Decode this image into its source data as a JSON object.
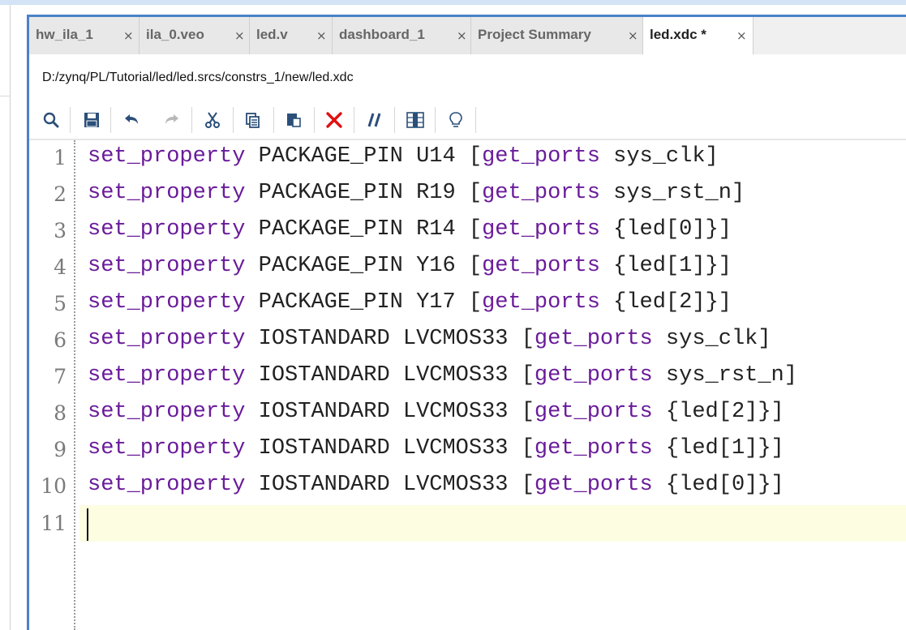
{
  "tabs": [
    {
      "label": "hw_ila_1",
      "active": false
    },
    {
      "label": "ila_0.veo",
      "active": false
    },
    {
      "label": "led.v",
      "active": false
    },
    {
      "label": "dashboard_1",
      "active": false
    },
    {
      "label": "Project Summary",
      "active": false
    },
    {
      "label": "led.xdc *",
      "active": true
    }
  ],
  "close_glyph": "×",
  "file_path": "D:/zynq/PL/Tutorial/led/led.srcs/constrs_1/new/led.xdc",
  "toolbar": [
    {
      "icon": "search-icon"
    },
    {
      "icon": "save-icon"
    },
    {
      "icon": "undo-icon"
    },
    {
      "icon": "redo-icon"
    },
    {
      "icon": "cut-icon"
    },
    {
      "icon": "copy-icon"
    },
    {
      "icon": "paste-icon"
    },
    {
      "icon": "delete-icon"
    },
    {
      "icon": "comment-icon"
    },
    {
      "icon": "column-select-icon"
    },
    {
      "icon": "lightbulb-icon"
    }
  ],
  "colors": {
    "keyword": "#6a1b9a",
    "frame_accent": "#4a82c8",
    "current_line": "#fdfde2",
    "delete_red": "#e01010"
  },
  "code_lines": [
    {
      "num": "1",
      "kw1": "set_property",
      "attr": " PACKAGE_PIN U14 [",
      "kw2": "get_ports",
      "tail": " sys_clk]"
    },
    {
      "num": "2",
      "kw1": "set_property",
      "attr": " PACKAGE_PIN R19 [",
      "kw2": "get_ports",
      "tail": " sys_rst_n]"
    },
    {
      "num": "3",
      "kw1": "set_property",
      "attr": " PACKAGE_PIN R14 [",
      "kw2": "get_ports",
      "tail": " {led[0]}]"
    },
    {
      "num": "4",
      "kw1": "set_property",
      "attr": " PACKAGE_PIN Y16 [",
      "kw2": "get_ports",
      "tail": " {led[1]}]"
    },
    {
      "num": "5",
      "kw1": "set_property",
      "attr": " PACKAGE_PIN Y17 [",
      "kw2": "get_ports",
      "tail": " {led[2]}]"
    },
    {
      "num": "6",
      "kw1": "set_property",
      "attr": " IOSTANDARD LVCMOS33 [",
      "kw2": "get_ports",
      "tail": " sys_clk]"
    },
    {
      "num": "7",
      "kw1": "set_property",
      "attr": " IOSTANDARD LVCMOS33 [",
      "kw2": "get_ports",
      "tail": " sys_rst_n]"
    },
    {
      "num": "8",
      "kw1": "set_property",
      "attr": " IOSTANDARD LVCMOS33 [",
      "kw2": "get_ports",
      "tail": " {led[2]}]"
    },
    {
      "num": "9",
      "kw1": "set_property",
      "attr": " IOSTANDARD LVCMOS33 [",
      "kw2": "get_ports",
      "tail": " {led[1]}]"
    },
    {
      "num": "10",
      "kw1": "set_property",
      "attr": " IOSTANDARD LVCMOS33 [",
      "kw2": "get_ports",
      "tail": " {led[0]}]"
    },
    {
      "num": "11",
      "kw1": "",
      "attr": "",
      "kw2": "",
      "tail": ""
    }
  ]
}
